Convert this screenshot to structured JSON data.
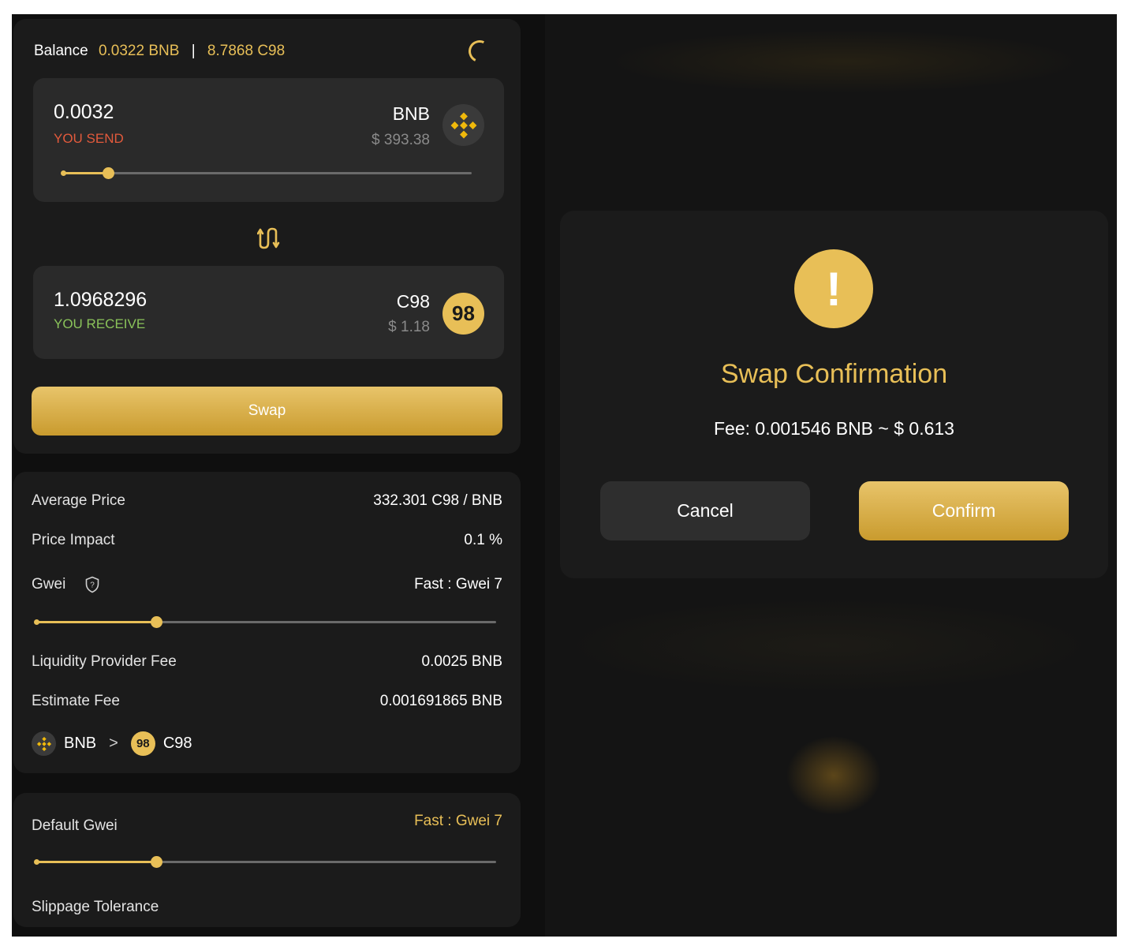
{
  "balance": {
    "label": "Balance",
    "bnb": "0.0322 BNB",
    "separator": "|",
    "c98": "8.7868 C98"
  },
  "send": {
    "amount": "0.0032",
    "label": "YOU SEND",
    "symbol": "BNB",
    "usd": "$ 393.38",
    "icon": "bnb-icon",
    "slider_percent": 11
  },
  "receive": {
    "amount": "1.0968296",
    "label": "YOU RECEIVE",
    "symbol": "C98",
    "usd": "$ 1.18",
    "icon": "c98-icon",
    "icon_text": "98"
  },
  "swap_button": "Swap",
  "details": {
    "average_price_label": "Average Price",
    "average_price_value": "332.301 C98 / BNB",
    "price_impact_label": "Price Impact",
    "price_impact_value": "0.1 %",
    "gwei_label": "Gwei",
    "gwei_value": "Fast : Gwei 7",
    "gwei_slider_percent": 26,
    "lp_fee_label": "Liquidity Provider Fee",
    "lp_fee_value": "0.0025 BNB",
    "estimate_fee_label": "Estimate Fee",
    "estimate_fee_value": "0.001691865 BNB",
    "route_from": "BNB",
    "route_arrow": ">",
    "route_to": "C98"
  },
  "settings": {
    "default_gwei_label": "Default Gwei",
    "default_gwei_value": "Fast : Gwei 7",
    "default_gwei_slider_percent": 26,
    "slippage_label": "Slippage Tolerance"
  },
  "modal": {
    "icon": "warning-icon",
    "icon_text": "!",
    "title": "Swap Confirmation",
    "fee": "Fee: 0.001546 BNB ~ $ 0.613",
    "cancel": "Cancel",
    "confirm": "Confirm"
  },
  "colors": {
    "accent": "#e8bf57",
    "send": "#e25a3c",
    "receive": "#8ac35a",
    "background": "#0f0f0f"
  }
}
